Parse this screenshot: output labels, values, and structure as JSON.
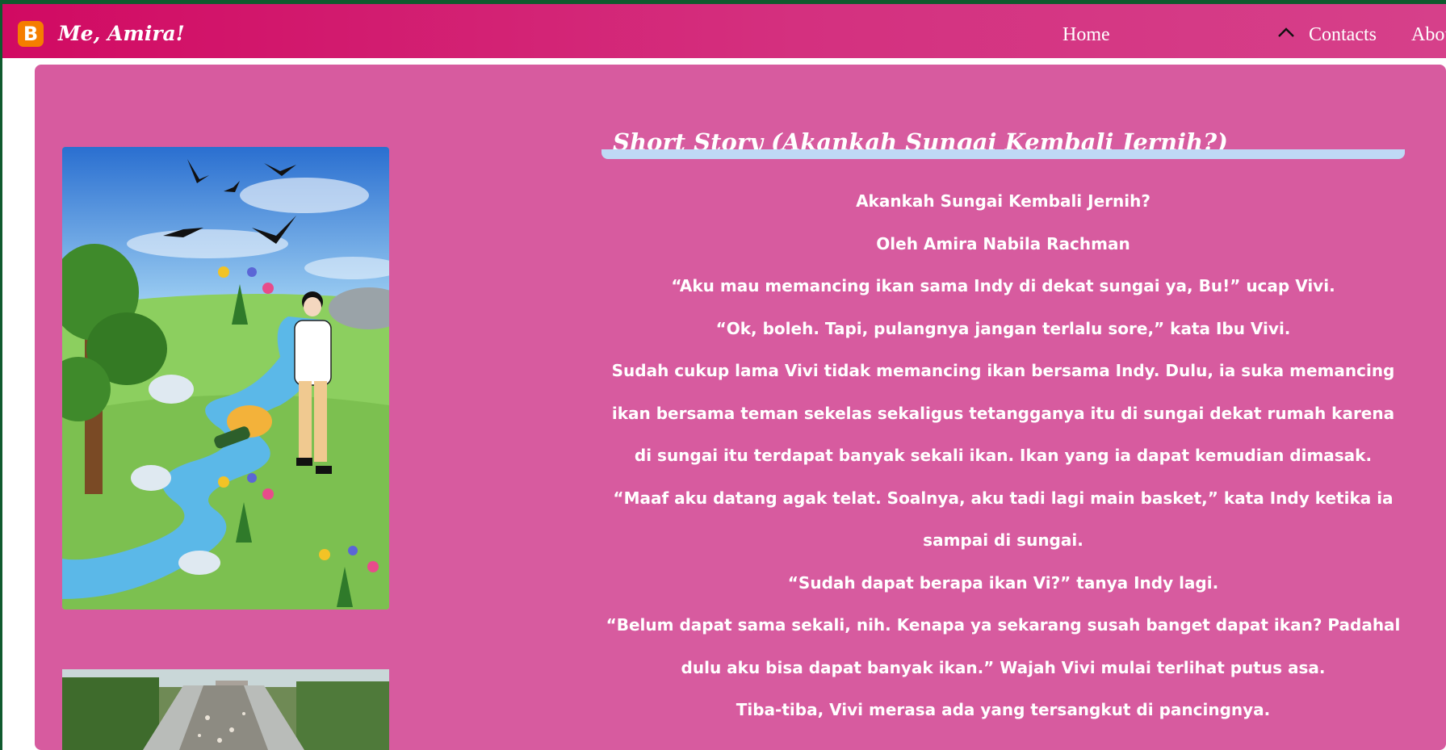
{
  "colors": {
    "frame": "#0f5a2e",
    "navbar_start": "#d10a62",
    "navbar_end": "#d6408a",
    "content_bg": "#d75b9f",
    "title_underline": "#bfd9f5",
    "blogger_logo": "#f57d00",
    "text": "#ffffff"
  },
  "header": {
    "logo_icon": "blogger-icon",
    "logo_glyph": "B",
    "site_title": "Me, Amira!",
    "nav": {
      "home": "Home",
      "expand_icon": "chevron-up-icon",
      "contacts": "Contacts",
      "about": "About"
    }
  },
  "post": {
    "title": "Short Story (Akankah Sungai Kembali Jernih?)",
    "paragraphs": [
      "Akankah Sungai Kembali Jernih?",
      "Oleh Amira Nabila Rachman",
      "“Aku mau memancing ikan sama Indy di dekat sungai ya, Bu!” ucap Vivi.",
      "“Ok, boleh. Tapi, pulangnya jangan terlalu sore,” kata Ibu Vivi.",
      "Sudah cukup lama Vivi tidak memancing ikan bersama Indy. Dulu, ia suka memancing ikan bersama teman sekelas sekaligus tetangganya itu di sungai dekat rumah karena di sungai itu terdapat banyak sekali ikan. Ikan yang ia dapat kemudian dimasak.",
      "“Maaf aku datang agak telat. Soalnya, aku tadi lagi main basket,” kata Indy ketika ia sampai di sungai.",
      "“Sudah dapat berapa ikan Vi?” tanya Indy lagi.",
      "“Belum dapat sama sekali, nih. Kenapa ya sekarang susah banget dapat ikan? Padahal dulu aku bisa dapat banyak ikan.” Wajah Vivi mulai terlihat putus asa.",
      "Tiba-tiba, Vivi merasa ada yang tersangkut di pancingnya."
    ]
  },
  "images": {
    "illustration": "river-illustration-image",
    "photo": "polluted-river-photo"
  }
}
